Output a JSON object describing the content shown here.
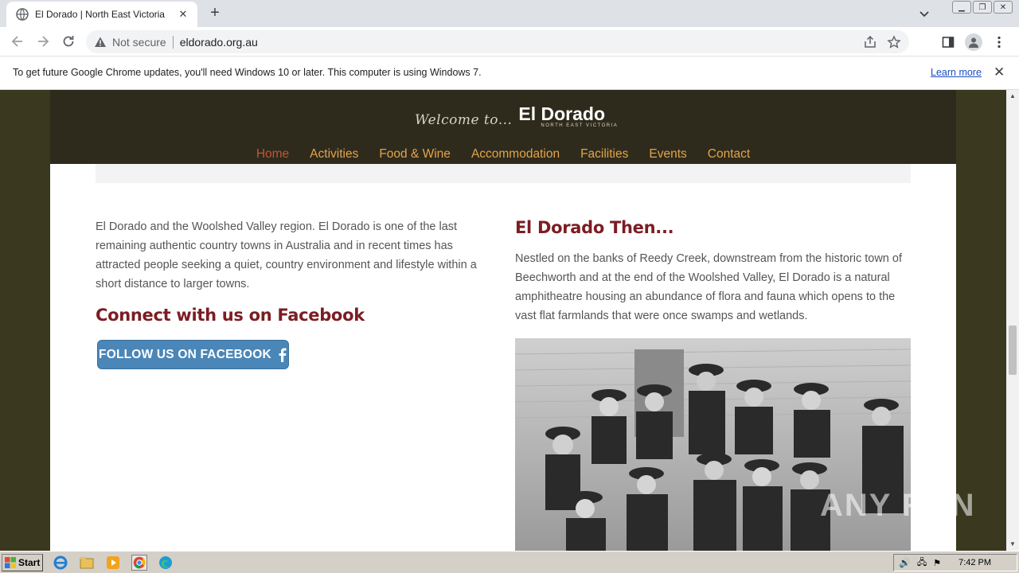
{
  "browser": {
    "tab_title": "El Dorado | North East Victoria",
    "security_label": "Not secure",
    "url": "eldorado.org.au",
    "infobar_message": "To get future Google Chrome updates, you'll need Windows 10 or later. This computer is using Windows 7.",
    "infobar_link": "Learn more"
  },
  "site": {
    "logo_welcome": "Welcome to...",
    "logo_name": "El Dorado",
    "logo_sub": "NORTH EAST VICTORIA",
    "nav": [
      "Home",
      "Activities",
      "Food & Wine",
      "Accommodation",
      "Facilities",
      "Events",
      "Contact"
    ],
    "intro_text": "El Dorado and the Woolshed Valley region. El Dorado is one of the last remaining authentic country towns in Australia and in recent times has attracted people seeking a quiet, country environment and lifestyle within a short distance to larger towns.",
    "facebook_heading": "Connect with us on Facebook",
    "facebook_button": "FOLLOW US ON FACEBOOK",
    "then_heading": "El Dorado Then...",
    "then_text": "Nestled on the banks of Reedy Creek, downstream from the historic town of Beechworth and at the end of the Woolshed Valley, El Dorado is a natural amphitheatre housing an abundance of flora and fauna which opens to the vast flat farmlands that were once swamps and wetlands."
  },
  "watermark": "ANY RUN",
  "taskbar": {
    "start_label": "Start",
    "clock": "7:42 PM"
  },
  "colors": {
    "header_bg": "#2e2b1c",
    "nav_link": "#e5a34a",
    "nav_active": "#c0543a",
    "heading": "#7b1d23",
    "facebook_button": "#4a86b8"
  }
}
